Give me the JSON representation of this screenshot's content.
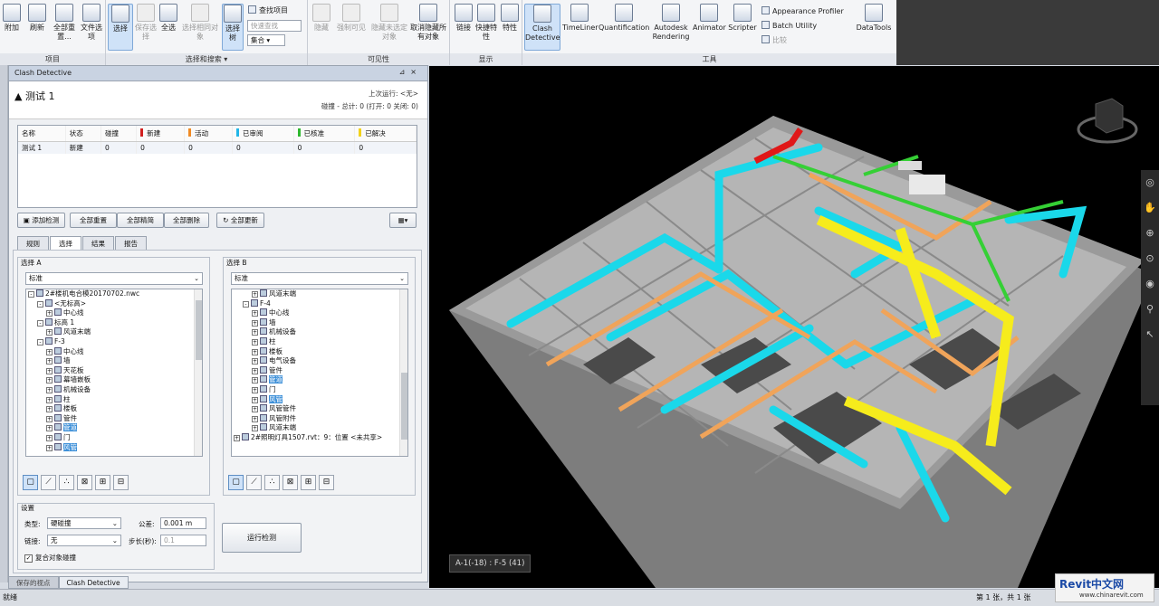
{
  "ribbon": {
    "groups": {
      "project": "项目",
      "select_search": "选择和搜索",
      "visibility": "可见性",
      "display": "显示",
      "tools": "工具"
    },
    "buttons": {
      "append": "附加",
      "refresh": "刷新",
      "reset_all": "全部重置...",
      "file_options": "文件选项",
      "select": "选择",
      "save_selection": "保存选择",
      "select_all": "全选",
      "select_same": "选择相同对象",
      "selection_tree": "选择树",
      "find_items": "查找项目",
      "quick_find": "快速查找",
      "sets": "集合",
      "hide": "隐藏",
      "require": "强制可见",
      "hide_unselected": "隐藏未选定对象",
      "unhide_all": "取消隐藏所有对象",
      "links": "链接",
      "quick_properties": "快捷特性",
      "properties": "特性",
      "clash_detective": "Clash Detective",
      "timeliner": "TimeLiner",
      "quantification": "Quantification",
      "autodesk_rendering": "Autodesk Rendering",
      "animator": "Animator",
      "scripter": "Scripter",
      "appearance_profiler": "Appearance Profiler",
      "batch_utility": "Batch Utility",
      "compare": "比较",
      "datatools": "DataTools"
    }
  },
  "panel": {
    "title": "Clash Detective",
    "test_name": "测试 1",
    "last_run": "上次运行: <无>",
    "summary": "碰撞 - 总计: 0 (打开: 0 关闭: 0)",
    "columns": [
      "名称",
      "状态",
      "碰撞",
      "新建",
      "活动",
      "已审阅",
      "已核准",
      "已解决"
    ],
    "column_colors": [
      "",
      "",
      "",
      "#d11f1f",
      "#f08a24",
      "#22b6e8",
      "#2eb82e",
      "#f2d21a"
    ],
    "row": [
      "测试 1",
      "新建",
      "0",
      "0",
      "0",
      "0",
      "0",
      "0"
    ],
    "buttons": {
      "add_test": "添加检测",
      "reset_all": "全部重置",
      "compact_all": "全部精简",
      "delete_all": "全部删除",
      "update_all": "全部更新"
    },
    "tabs": [
      "规则",
      "选择",
      "结果",
      "报告"
    ],
    "active_tab": "选择",
    "selection_a": {
      "label": "选择 A",
      "combo": "标准",
      "items": [
        {
          "indent": 0,
          "box": "-",
          "text": "2#楼机电合模20170702.nwc",
          "sel": false
        },
        {
          "indent": 1,
          "box": "-",
          "text": "<无标高>",
          "sel": false
        },
        {
          "indent": 2,
          "box": "+",
          "text": "中心线",
          "sel": false
        },
        {
          "indent": 1,
          "box": "-",
          "text": "标高 1",
          "sel": false
        },
        {
          "indent": 2,
          "box": "+",
          "text": "风道末端",
          "sel": false
        },
        {
          "indent": 1,
          "box": "-",
          "text": "F-3",
          "sel": false
        },
        {
          "indent": 2,
          "box": "+",
          "text": "中心线",
          "sel": false
        },
        {
          "indent": 2,
          "box": "+",
          "text": "墙",
          "sel": false
        },
        {
          "indent": 2,
          "box": "+",
          "text": "天花板",
          "sel": false
        },
        {
          "indent": 2,
          "box": "+",
          "text": "幕墙嵌板",
          "sel": false
        },
        {
          "indent": 2,
          "box": "+",
          "text": "机械设备",
          "sel": false
        },
        {
          "indent": 2,
          "box": "+",
          "text": "柱",
          "sel": false
        },
        {
          "indent": 2,
          "box": "+",
          "text": "楼板",
          "sel": false
        },
        {
          "indent": 2,
          "box": "+",
          "text": "管件",
          "sel": false
        },
        {
          "indent": 2,
          "box": "+",
          "text": "管道",
          "sel": true
        },
        {
          "indent": 2,
          "box": "+",
          "text": "门",
          "sel": false
        },
        {
          "indent": 2,
          "box": "+",
          "text": "风管",
          "sel": true
        }
      ]
    },
    "selection_b": {
      "label": "选择 B",
      "combo": "标准",
      "items": [
        {
          "indent": 2,
          "box": "+",
          "text": "风道末端",
          "sel": false
        },
        {
          "indent": 1,
          "box": "-",
          "text": "F-4",
          "sel": false
        },
        {
          "indent": 2,
          "box": "+",
          "text": "中心线",
          "sel": false
        },
        {
          "indent": 2,
          "box": "+",
          "text": "墙",
          "sel": false
        },
        {
          "indent": 2,
          "box": "+",
          "text": "机械设备",
          "sel": false
        },
        {
          "indent": 2,
          "box": "+",
          "text": "柱",
          "sel": false
        },
        {
          "indent": 2,
          "box": "+",
          "text": "楼板",
          "sel": false
        },
        {
          "indent": 2,
          "box": "+",
          "text": "电气设备",
          "sel": false
        },
        {
          "indent": 2,
          "box": "+",
          "text": "管件",
          "sel": false
        },
        {
          "indent": 2,
          "box": "+",
          "text": "管道",
          "sel": true
        },
        {
          "indent": 2,
          "box": "+",
          "text": "门",
          "sel": false
        },
        {
          "indent": 2,
          "box": "+",
          "text": "风管",
          "sel": true
        },
        {
          "indent": 2,
          "box": "+",
          "text": "风管管件",
          "sel": false
        },
        {
          "indent": 2,
          "box": "+",
          "text": "风管附件",
          "sel": false
        },
        {
          "indent": 2,
          "box": "+",
          "text": "风道末端",
          "sel": false
        },
        {
          "indent": 0,
          "box": "+",
          "text": "2#照明灯具1507.rvt：9：位置 <未共享>",
          "sel": false
        }
      ]
    },
    "settings": {
      "label": "设置",
      "type_label": "类型:",
      "type_value": "硬碰撞",
      "tolerance_label": "公差:",
      "tolerance_value": "0.001 m",
      "link_label": "链接:",
      "link_value": "无",
      "step_label": "步长(秒):",
      "step_value": "0.1",
      "composite_label": "复合对象碰撞",
      "run": "运行检测"
    }
  },
  "bottom_tabs": [
    "保存的视点",
    "Clash Detective"
  ],
  "viewport": {
    "coord_label": "A-1(-18) : F-5 (41)"
  },
  "status": {
    "left": "就绪",
    "page": "第 1 张，共 1 张"
  },
  "watermark": {
    "text": "Revit中文网",
    "url": "www.chinarevit.com"
  }
}
